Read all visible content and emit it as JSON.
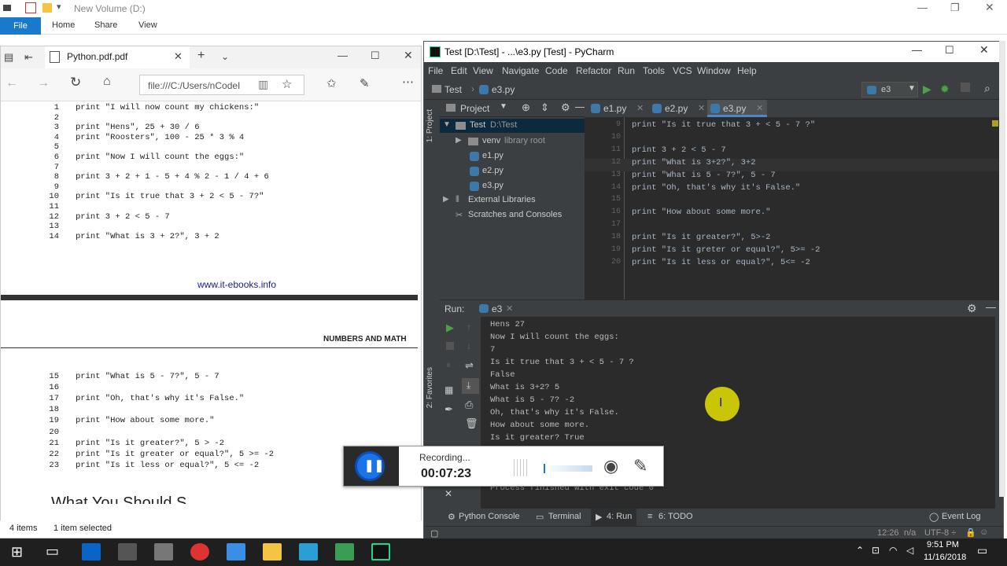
{
  "explorer": {
    "title": "New Volume (D:)",
    "ribbon": {
      "file": "File",
      "home": "Home",
      "share": "Share",
      "view": "View"
    },
    "status": {
      "items": "4 items",
      "selected": "1 item selected"
    }
  },
  "edge": {
    "tab_title": "Python.pdf.pdf",
    "address": "file:///C:/Users/nCodeI",
    "pdf": {
      "lines_top": [
        {
          "n": "1",
          "code": "print \"I will now count my chickens:\""
        },
        {
          "n": "2",
          "code": ""
        },
        {
          "n": "3",
          "code": "print \"Hens\", 25 + 30 / 6"
        },
        {
          "n": "4",
          "code": "print \"Roosters\", 100 - 25 * 3 % 4"
        },
        {
          "n": "5",
          "code": ""
        },
        {
          "n": "6",
          "code": "print \"Now I will count the eggs:\""
        },
        {
          "n": "7",
          "code": ""
        },
        {
          "n": "8",
          "code": "print 3 + 2 + 1 - 5 + 4 % 2 - 1 / 4 + 6"
        },
        {
          "n": "9",
          "code": ""
        },
        {
          "n": "10",
          "code": "print \"Is it true that 3 + 2 < 5 - 7?\""
        },
        {
          "n": "11",
          "code": ""
        },
        {
          "n": "12",
          "code": "print 3 + 2 < 5 - 7"
        },
        {
          "n": "13",
          "code": ""
        },
        {
          "n": "14",
          "code": "print \"What is 3 + 2?\", 3 + 2"
        }
      ],
      "link": "www.it-ebooks.info",
      "header": "NUMBERS AND MATH",
      "lines_bottom": [
        {
          "n": "15",
          "code": "print \"What is 5 - 7?\", 5 - 7"
        },
        {
          "n": "16",
          "code": ""
        },
        {
          "n": "17",
          "code": "print \"Oh, that's why it's False.\""
        },
        {
          "n": "18",
          "code": ""
        },
        {
          "n": "19",
          "code": "print \"How about some more.\""
        },
        {
          "n": "20",
          "code": ""
        },
        {
          "n": "21",
          "code": "print \"Is it greater?\", 5 > -2"
        },
        {
          "n": "22",
          "code": "print \"Is it greater or equal?\", 5 >= -2"
        },
        {
          "n": "23",
          "code": "print \"Is it less or equal?\", 5 <= -2"
        }
      ],
      "partial_heading": "What You Should S"
    }
  },
  "pycharm": {
    "title": "Test [D:\\Test] - ...\\e3.py [Test] - PyCharm",
    "menu": [
      "File",
      "Edit",
      "View",
      "Navigate",
      "Code",
      "Refactor",
      "Run",
      "Tools",
      "VCS",
      "Window",
      "Help"
    ],
    "breadcrumb": {
      "project": "Test",
      "file": "e3.py"
    },
    "run_config": "e3",
    "project_panel": {
      "label": "Project",
      "side_label": "1: Project",
      "root": "Test",
      "root_path": "D:\\Test",
      "venv": "venv",
      "venv_note": "library root",
      "files": [
        "e1.py",
        "e2.py",
        "e3.py"
      ],
      "external": "External Libraries",
      "scratches": "Scratches and Consoles"
    },
    "tabs": [
      "e1.py",
      "e2.py",
      "e3.py"
    ],
    "editor": [
      {
        "n": "9",
        "code": "print \"Is it true that 3 + < 5 - 7 ?\""
      },
      {
        "n": "10",
        "code": ""
      },
      {
        "n": "11",
        "code": "print 3 + 2 < 5 - 7"
      },
      {
        "n": "12",
        "code": "print \"What is 3+2?\", 3+2"
      },
      {
        "n": "13",
        "code": "print \"What is 5 - 7?\", 5 - 7"
      },
      {
        "n": "14",
        "code": "print \"Oh, that's why it's False.\""
      },
      {
        "n": "15",
        "code": ""
      },
      {
        "n": "16",
        "code": "print \"How about some more.\""
      },
      {
        "n": "17",
        "code": ""
      },
      {
        "n": "18",
        "code": "print \"Is it greater?\", 5>-2"
      },
      {
        "n": "19",
        "code": "print \"Is it greter or equal?\", 5>= -2"
      },
      {
        "n": "20",
        "code": "print \"Is it less or equal?\", 5<= -2"
      }
    ],
    "run": {
      "label": "Run:",
      "config": "e3",
      "favorites_label": "2: Favorites",
      "output": [
        "Hens 27",
        "Now I will count the eggs:",
        "7",
        "Is it true that 3 + < 5 - 7 ?",
        "False",
        "What is 3+2? 5",
        "What is 5 - 7? -2",
        "Oh, that's why it's False.",
        "How about some more.",
        "Is it greater? True"
      ],
      "exit": "Process finished with exit code 0"
    },
    "bottom_tabs": [
      "Python Console",
      "Terminal",
      "4: Run",
      "6: TODO"
    ],
    "event_log": "Event Log",
    "status": {
      "position": "12:26",
      "na": "n/a",
      "encoding": "UTF-8 ÷"
    }
  },
  "recorder": {
    "label": "Recording...",
    "time": "00:07:23"
  },
  "taskbar": {
    "time": "9:51 PM",
    "date": "11/16/2018"
  }
}
